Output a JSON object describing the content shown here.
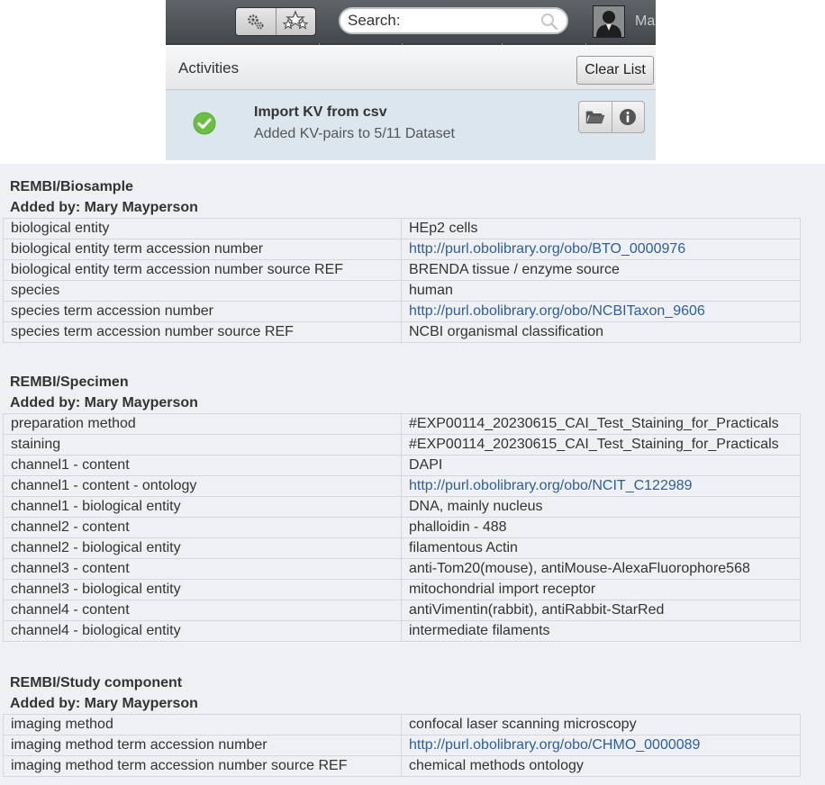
{
  "toolbar": {
    "search_placeholder": "Search:",
    "username": "Ma"
  },
  "activities": {
    "title": "Activities",
    "clear_label": "Clear List",
    "item": {
      "name": "Import KV from csv",
      "message": "Added KV-pairs to 5/11 Dataset",
      "status": "success"
    }
  },
  "annotations": [
    {
      "namespace": "REMBI/Biosample",
      "added_by": "Added by: Mary Mayperson",
      "rows": [
        {
          "key": "biological entity",
          "value": "HEp2 cells",
          "link": false
        },
        {
          "key": "biological entity term accession number",
          "value": "http://purl.obolibrary.org/obo/BTO_0000976",
          "link": true
        },
        {
          "key": "biological entity term accession number source REF",
          "value": "BRENDA tissue / enzyme source",
          "link": false
        },
        {
          "key": "species",
          "value": "human",
          "link": false
        },
        {
          "key": "species term accession number",
          "value": "http://purl.obolibrary.org/obo/NCBITaxon_9606",
          "link": true
        },
        {
          "key": "species term accession number source REF",
          "value": "NCBI organismal classification",
          "link": false
        }
      ]
    },
    {
      "namespace": "REMBI/Specimen",
      "added_by": "Added by: Mary Mayperson",
      "rows": [
        {
          "key": "preparation method",
          "value": "#EXP00114_20230615_CAI_Test_Staining_for_Practicals",
          "link": false
        },
        {
          "key": "staining",
          "value": "#EXP00114_20230615_CAI_Test_Staining_for_Practicals",
          "link": false
        },
        {
          "key": "channel1 - content",
          "value": "DAPI",
          "link": false
        },
        {
          "key": "channel1 - content - ontology",
          "value": "http://purl.obolibrary.org/obo/NCIT_C122989",
          "link": true
        },
        {
          "key": "channel1 - biological entity",
          "value": "DNA, mainly nucleus",
          "link": false
        },
        {
          "key": "channel2 - content",
          "value": "phalloidin - 488",
          "link": false
        },
        {
          "key": "channel2 - biological entity",
          "value": "filamentous Actin",
          "link": false
        },
        {
          "key": "channel3 - content",
          "value": "anti-Tom20(mouse), antiMouse-AlexaFluorophore568",
          "link": false
        },
        {
          "key": "channel3 - biological entity",
          "value": "mitochondrial import receptor",
          "link": false
        },
        {
          "key": "channel4 - content",
          "value": "antiVimentin(rabbit), antiRabbit-StarRed",
          "link": false
        },
        {
          "key": "channel4 - biological entity",
          "value": "intermediate filaments",
          "link": false
        }
      ]
    },
    {
      "namespace": "REMBI/Study component",
      "added_by": "Added by: Mary Mayperson",
      "rows": [
        {
          "key": "imaging method",
          "value": "confocal laser scanning microscopy",
          "link": false
        },
        {
          "key": "imaging method term accession number",
          "value": "http://purl.obolibrary.org/obo/CHMO_0000089",
          "link": true
        },
        {
          "key": "imaging method term accession number source REF",
          "value": "chemical methods ontology",
          "link": false
        }
      ]
    }
  ],
  "colors": {
    "link": "#2e5f9b",
    "success": "#6cbf43",
    "toolbar": "#4f5357",
    "activity_bg": "#dce6ef"
  }
}
